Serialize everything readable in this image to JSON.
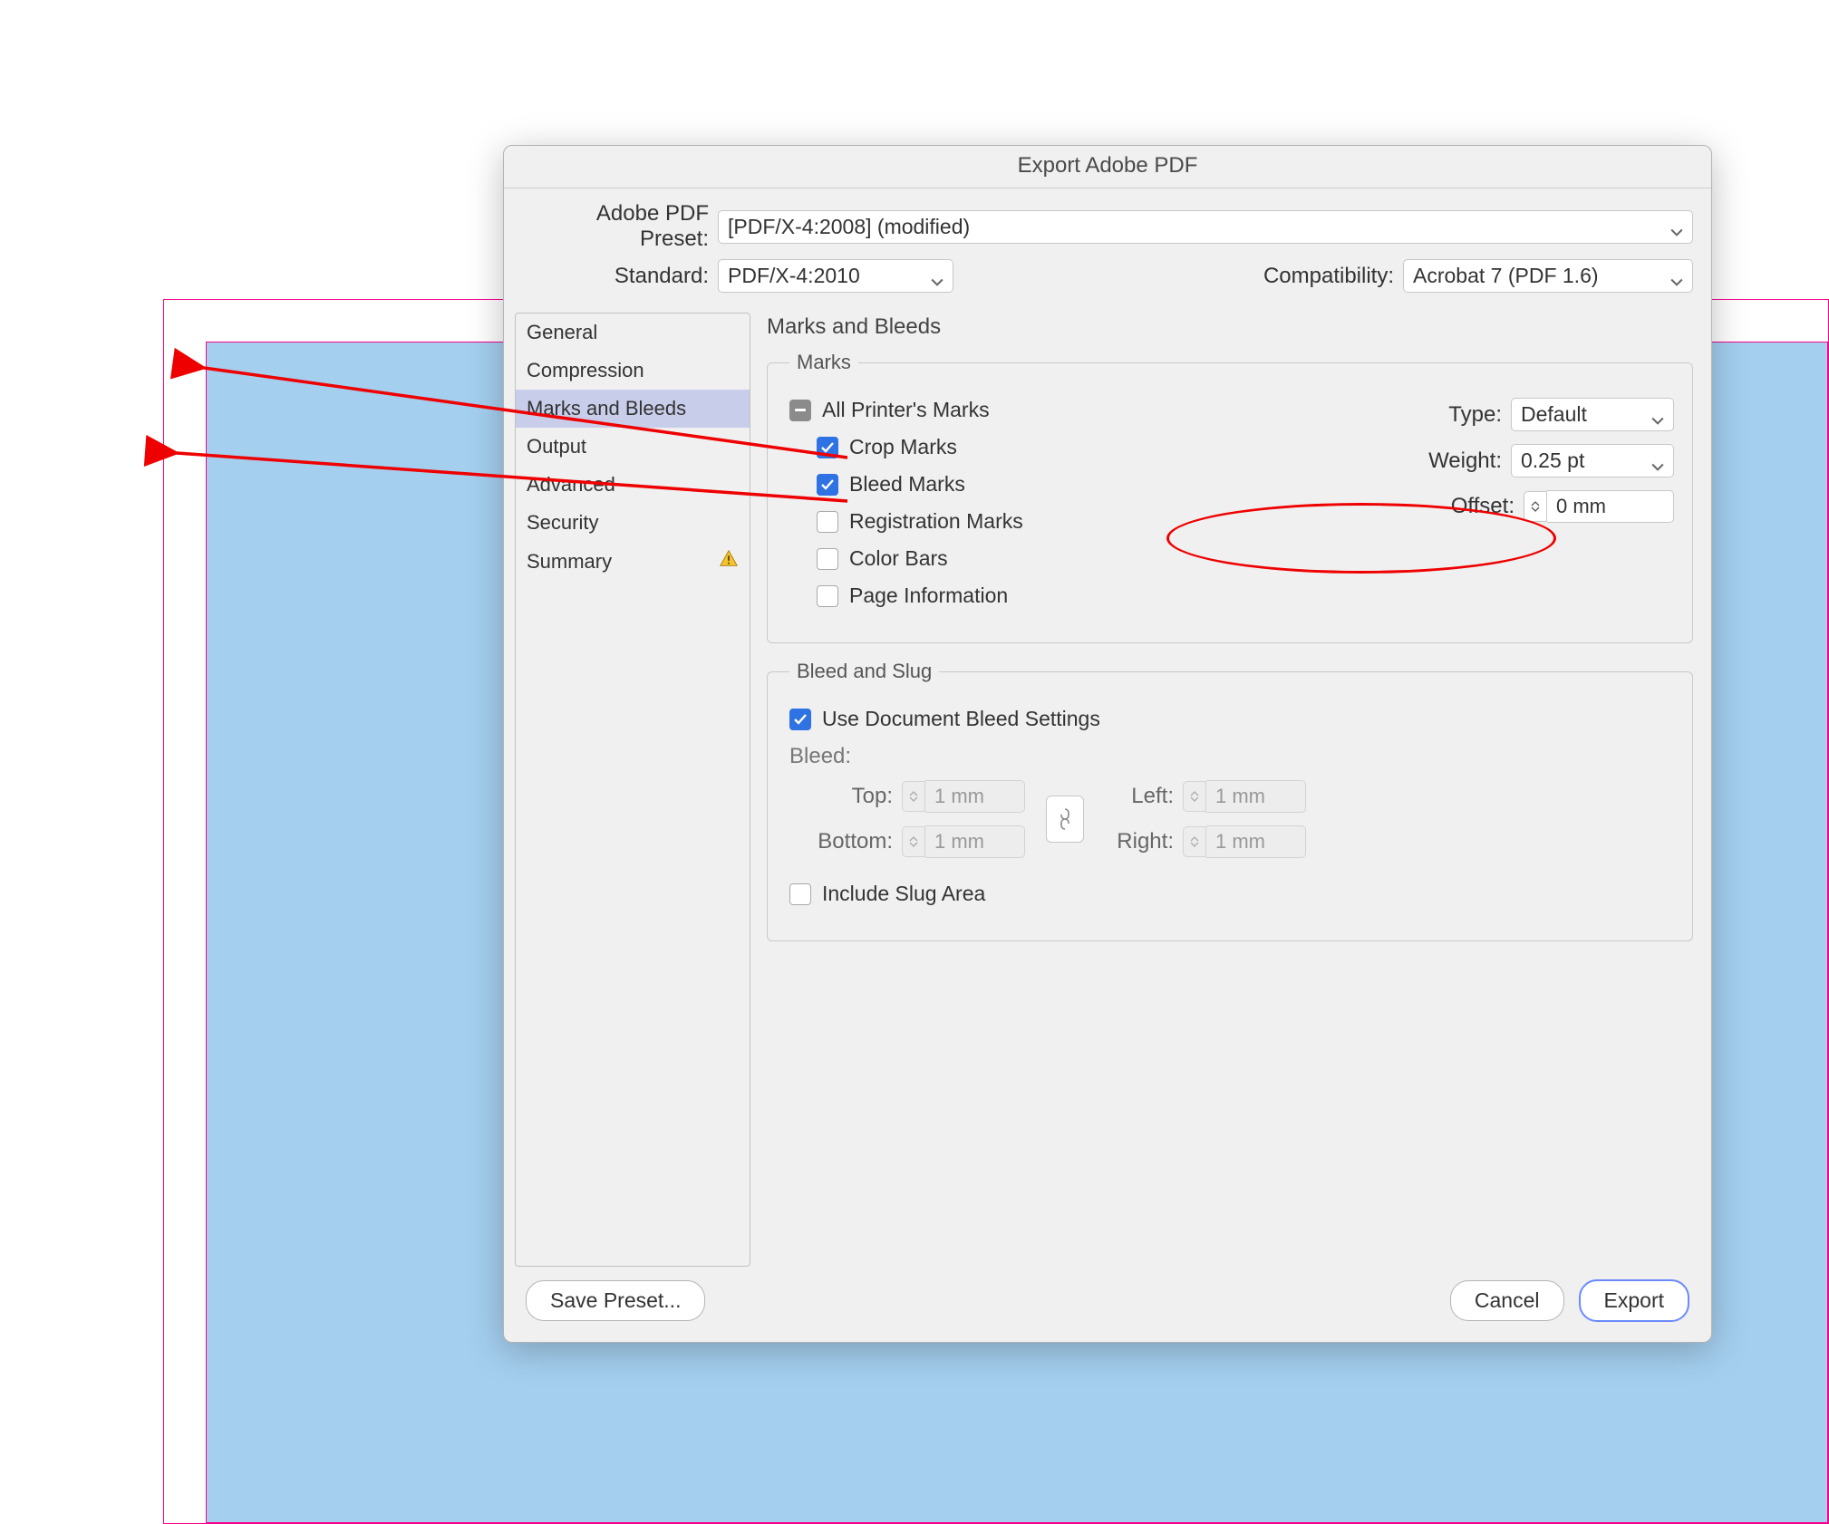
{
  "dialog": {
    "title": "Export Adobe PDF",
    "preset_label": "Adobe PDF Preset:",
    "preset_value": "[PDF/X-4:2008] (modified)",
    "standard_label": "Standard:",
    "standard_value": "PDF/X-4:2010",
    "compat_label": "Compatibility:",
    "compat_value": "Acrobat 7 (PDF 1.6)"
  },
  "sidebar": {
    "items": [
      {
        "label": "General"
      },
      {
        "label": "Compression"
      },
      {
        "label": "Marks and Bleeds"
      },
      {
        "label": "Output"
      },
      {
        "label": "Advanced"
      },
      {
        "label": "Security"
      },
      {
        "label": "Summary"
      }
    ]
  },
  "panel": {
    "title": "Marks and Bleeds",
    "marks_legend": "Marks",
    "all_marks": "All Printer's Marks",
    "crop": "Crop Marks",
    "bleedm": "Bleed Marks",
    "reg": "Registration Marks",
    "color": "Color Bars",
    "pageinfo": "Page Information",
    "type_label": "Type:",
    "type_value": "Default",
    "weight_label": "Weight:",
    "weight_value": "0.25 pt",
    "offset_label": "Offset:",
    "offset_value": "0 mm",
    "bs_legend": "Bleed and Slug",
    "use_doc": "Use Document Bleed Settings",
    "bleed_heading": "Bleed:",
    "top_l": "Top:",
    "top_v": "1 mm",
    "bot_l": "Bottom:",
    "bot_v": "1 mm",
    "left_l": "Left:",
    "left_v": "1 mm",
    "right_l": "Right:",
    "right_v": "1 mm",
    "slug": "Include Slug Area"
  },
  "footer": {
    "save": "Save Preset...",
    "cancel": "Cancel",
    "export": "Export"
  }
}
